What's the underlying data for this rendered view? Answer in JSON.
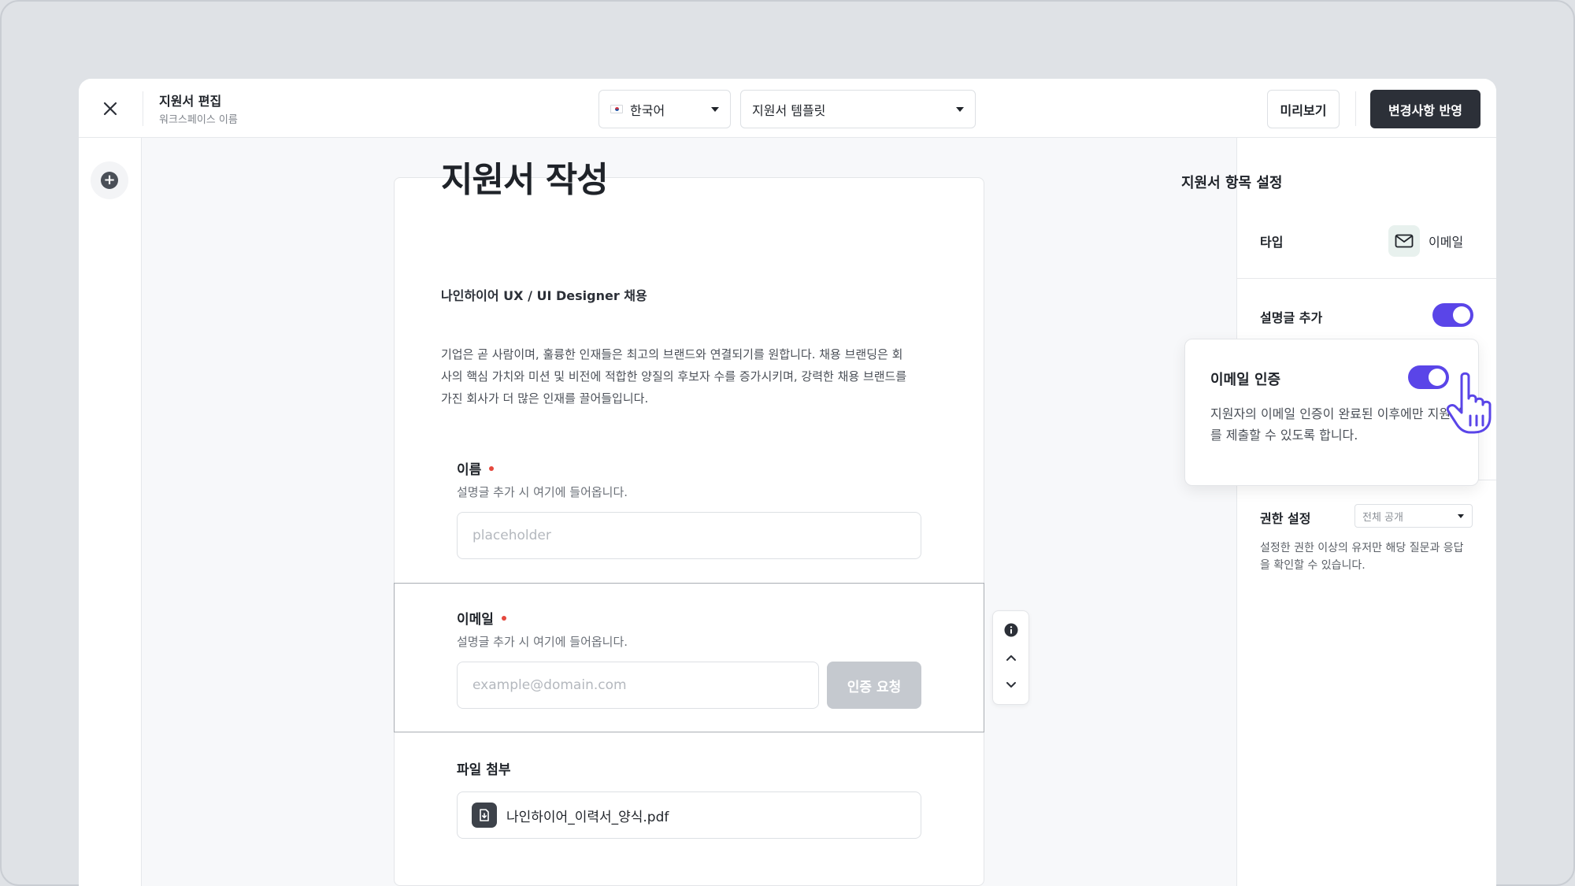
{
  "header": {
    "title": "지원서 편집",
    "subtitle": "워크스페이스 이름",
    "language": "한국어",
    "template": "지원서 템플릿",
    "preview_label": "미리보기",
    "apply_label": "변경사항 반영"
  },
  "form": {
    "title": "지원서 작성",
    "subtitle": "나인하이어 UX / UI Designer 채용",
    "description": "기업은 곧 사람이며, 훌륭한 인재들은 최고의 브랜드와 연결되기를 원합니다. 채용 브랜딩은 회사의 핵심 가치와 미션 및 비전에 적합한 양질의 후보자 수를 증가시키며, 강력한 채용 브랜드를 가진 회사가 더 많은 인재를 끌어들입니다.",
    "name_field": {
      "label": "이름",
      "help": "설명글 추가 시 여기에 들어옵니다.",
      "placeholder": "placeholder"
    },
    "email_field": {
      "label": "이메일",
      "help": "설명글 추가 시 여기에 들어옵니다.",
      "placeholder": "example@domain.com",
      "verify_label": "인증 요청"
    },
    "file_field": {
      "label": "파일 첨부",
      "filename": "나인하이어_이력서_양식.pdf"
    }
  },
  "panel": {
    "title": "지원서 항목 설정",
    "type_label": "타입",
    "type_value": "이메일",
    "add_description_label": "설명글 추가",
    "permission_label": "권한 설정",
    "permission_value": "전체 공개",
    "permission_desc": "설정한 권한 이상의 유저만 해당 질문과 응답을 확인할 수 있습니다."
  },
  "popup": {
    "title": "이메일 인증",
    "description": "지원자의 이메일 인증이 완료된 이후에만 지원서를 제출할 수 있도록 합니다."
  },
  "colors": {
    "accent": "#5a45e8",
    "dark_button": "#2c3038",
    "required_dot": "#e5483d",
    "disabled_button": "#c5c9cf"
  }
}
